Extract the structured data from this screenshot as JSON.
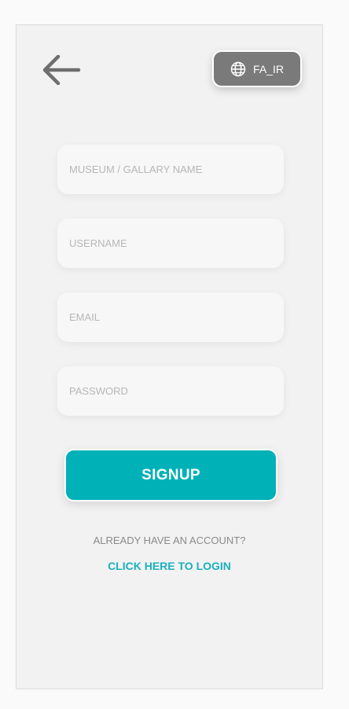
{
  "language": {
    "label": "FA_IR",
    "icon": "globe-icon"
  },
  "back": {
    "icon": "arrow-left-icon"
  },
  "form": {
    "museum_placeholder": "MUSEUM / GALLARY NAME",
    "username_placeholder": "USERNAME",
    "email_placeholder": "EMAIL",
    "password_placeholder": "PASSWORD"
  },
  "signup": {
    "label": "SIGNUP"
  },
  "footer": {
    "question": "ALREADY HAVE AN ACCOUNT?",
    "login_link": "CLICK HERE TO LOGIN"
  },
  "colors": {
    "accent": "#00b1b8",
    "link": "#1ab0bd",
    "lang_bg": "#7a7a7a",
    "card_bg": "#f2f2f2"
  }
}
